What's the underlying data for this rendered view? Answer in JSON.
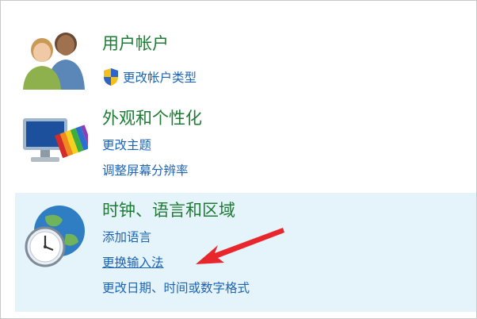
{
  "categories": {
    "users": {
      "title": "用户帐户",
      "links": [
        "更改帐户类型"
      ]
    },
    "appearance": {
      "title": "外观和个性化",
      "links": [
        "更改主题",
        "调整屏幕分辨率"
      ]
    },
    "clock": {
      "title": "时钟、语言和区域",
      "links": [
        "添加语言",
        "更换输入法",
        "更改日期、时间或数字格式"
      ]
    }
  },
  "colors": {
    "title_green": "#1e7b34",
    "link_blue": "#1e64b4",
    "highlight_bg": "#e5f3fb",
    "arrow_red": "#e8272c"
  },
  "icons": [
    "users-icon",
    "uac-shield-icon",
    "monitor-color-icon",
    "globe-clock-icon",
    "red-arrow-icon"
  ]
}
